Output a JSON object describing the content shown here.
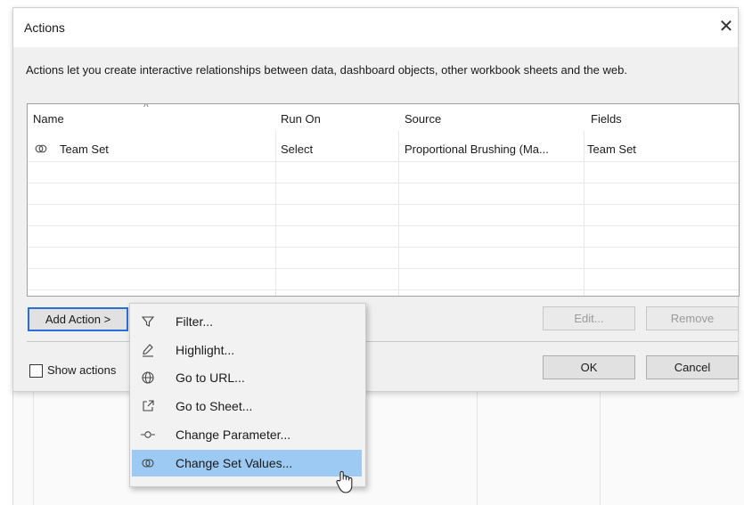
{
  "dialog": {
    "title": "Actions",
    "close_glyph": "✕",
    "description": "Actions let you create interactive relationships between data, dashboard objects, other workbook sheets and the web."
  },
  "table": {
    "columns": [
      "Name",
      "Run On",
      "Source",
      "Fields"
    ],
    "rows": [
      {
        "icon": "change-set-icon",
        "name": "Team Set",
        "run_on": "Select",
        "source": "Proportional Brushing (Ma...",
        "fields": "Team Set"
      }
    ]
  },
  "buttons": {
    "add_action": "Add Action >",
    "edit": "Edit...",
    "remove": "Remove",
    "ok": "OK",
    "cancel": "Cancel"
  },
  "checkbox": {
    "label": "Show actions",
    "checked": false
  },
  "menu": {
    "items": [
      {
        "icon": "filter-icon",
        "label": "Filter..."
      },
      {
        "icon": "highlight-icon",
        "label": "Highlight..."
      },
      {
        "icon": "globe-icon",
        "label": "Go to URL..."
      },
      {
        "icon": "go-to-sheet-icon",
        "label": "Go to Sheet..."
      },
      {
        "icon": "change-parameter-icon",
        "label": "Change Parameter..."
      },
      {
        "icon": "change-set-icon",
        "label": "Change Set Values...",
        "selected": true
      }
    ]
  },
  "colors": {
    "selection": "#9ccaf3",
    "focus_border": "#2a6fd6"
  }
}
